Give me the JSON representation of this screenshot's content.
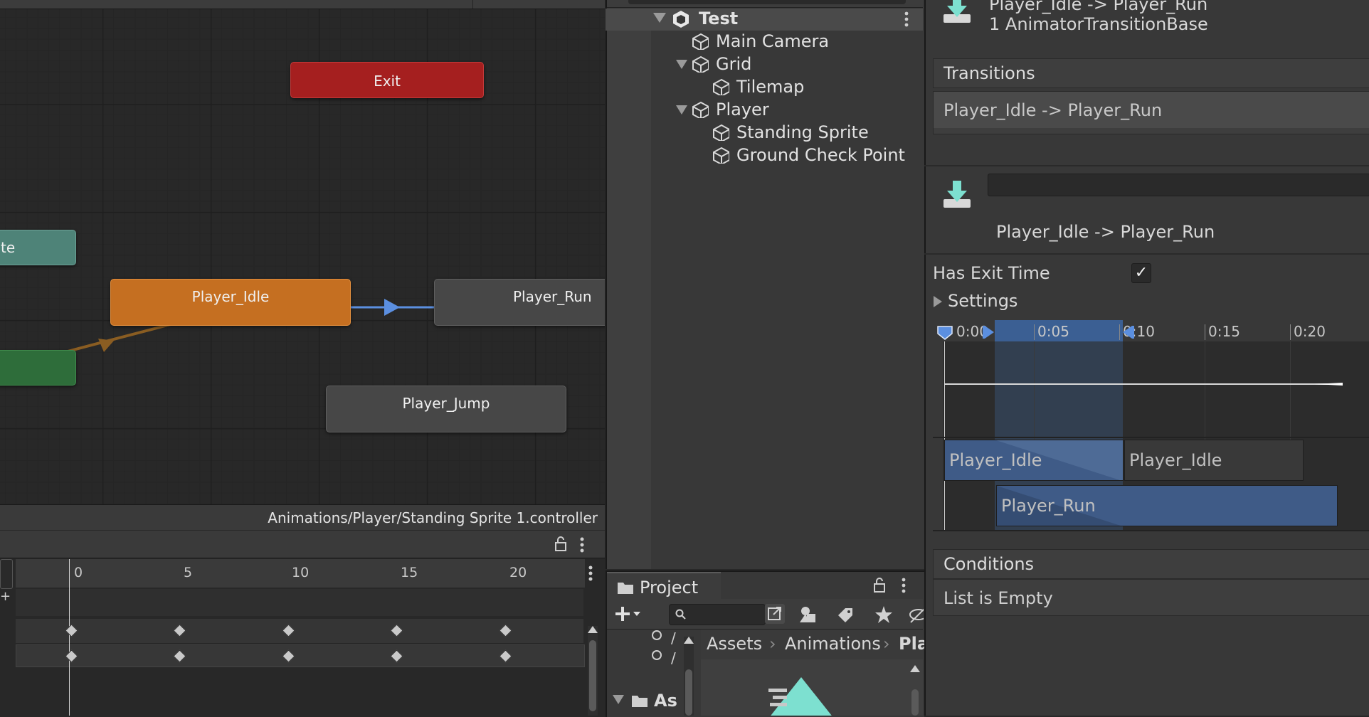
{
  "animator": {
    "nodes": {
      "exit": "Exit",
      "any_state_partial": "te",
      "player_idle": "Player_Idle",
      "player_run": "Player_Run",
      "player_jump": "Player_Jump",
      "entry_partial": ""
    },
    "controller_path": "Animations/Player/Standing Sprite 1.controller"
  },
  "animation_panel": {
    "ruler_ticks": [
      "0",
      "5",
      "10",
      "15",
      "20"
    ]
  },
  "hierarchy": {
    "scene": "Test",
    "items": [
      {
        "label": "Main Camera",
        "depth": 1,
        "expanded": null
      },
      {
        "label": "Grid",
        "depth": 1,
        "expanded": true
      },
      {
        "label": "Tilemap",
        "depth": 2,
        "expanded": null
      },
      {
        "label": "Player",
        "depth": 1,
        "expanded": true
      },
      {
        "label": "Standing Sprite",
        "depth": 2,
        "expanded": null
      },
      {
        "label": "Ground Check Point",
        "depth": 2,
        "expanded": null
      }
    ]
  },
  "project": {
    "tab_label": "Project",
    "breadcrumb": [
      "Assets",
      "Animations",
      "Pla"
    ],
    "left_tree_partial": "As"
  },
  "inspector": {
    "header_title_partial": "Player_Idle -> Player_Run",
    "header_subtitle": "1 AnimatorTransitionBase",
    "transitions_label": "Transitions",
    "transition_item": "Player_Idle -> Player_Run",
    "transition_name": "Player_Idle -> Player_Run",
    "has_exit_time_label": "Has Exit Time",
    "has_exit_time": true,
    "settings_label": "Settings",
    "timeline_ticks": [
      "0:00",
      "0:05",
      "0:10",
      "0:15",
      "0:20"
    ],
    "clips": {
      "idle_a": "Player_Idle",
      "idle_b": "Player_Idle",
      "run": "Player_Run"
    },
    "conditions_label": "Conditions",
    "conditions_empty": "List is Empty"
  },
  "colors": {
    "exit_node": "#a51f1f",
    "idle_node": "#c56f21",
    "any_state_node": "#4e8378",
    "entry_node": "#2e6d3a",
    "transition_arrow": "#5b8fe0",
    "selection_blue": "#3f5b87",
    "teal_icon": "#7de0d0"
  }
}
